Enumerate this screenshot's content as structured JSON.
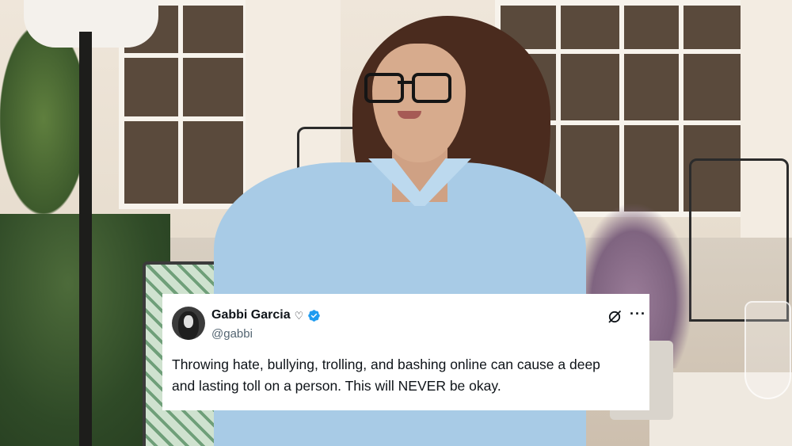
{
  "tweet": {
    "display_name": "Gabbi Garcia",
    "name_emoji": "♡",
    "handle": "@gabbi",
    "text_lines": [
      "Throwing hate, bullying, trolling, and bashing online can cause a deep",
      "and lasting toll on a person. This will NEVER be okay."
    ],
    "more_label": "···"
  },
  "icons": {
    "avatar": "avatar",
    "verified": "verified-badge-icon",
    "grok": "grok-icon",
    "more": "more-options-icon"
  },
  "colors": {
    "verified_blue": "#1d9bf0",
    "text_primary": "#0f1419",
    "text_secondary": "#536471",
    "card_background": "#ffffff"
  }
}
